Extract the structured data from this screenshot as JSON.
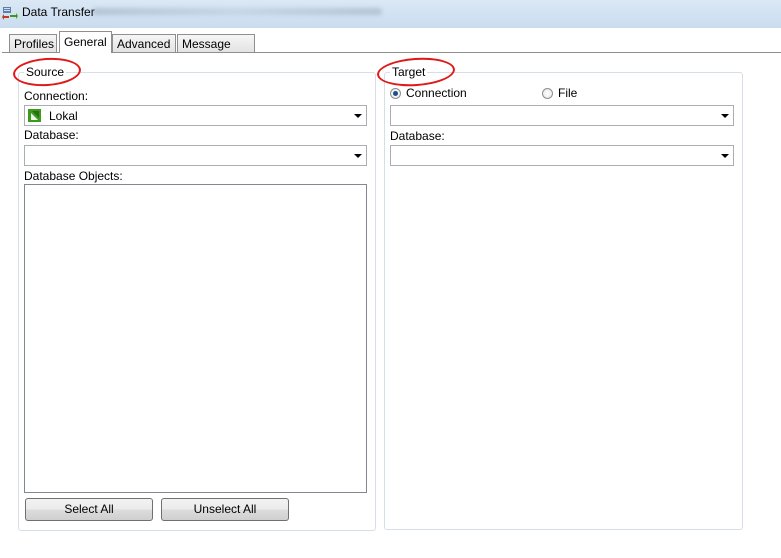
{
  "window": {
    "title": "Data Transfer",
    "app_icon": "data-transfer-icon"
  },
  "tabs": [
    {
      "label": "Profiles",
      "active": false
    },
    {
      "label": "General",
      "active": true
    },
    {
      "label": "Advanced",
      "active": false
    },
    {
      "label": "Message Log",
      "active": false
    }
  ],
  "source": {
    "title": "Source",
    "connection_label": "Connection:",
    "connection_value": "Lokal",
    "connection_icon": "connection-icon",
    "database_label": "Database:",
    "database_value": "",
    "objects_label": "Database Objects:",
    "objects": [],
    "select_all_label": "Select All",
    "unselect_all_label": "Unselect All"
  },
  "target": {
    "title": "Target",
    "mode_connection_label": "Connection",
    "mode_file_label": "File",
    "selected_mode": "Connection",
    "connection_value": "",
    "database_label": "Database:",
    "database_value": ""
  },
  "colors": {
    "annotation_red": "#e01818",
    "connection_icon_green": "#3c9a1e"
  }
}
